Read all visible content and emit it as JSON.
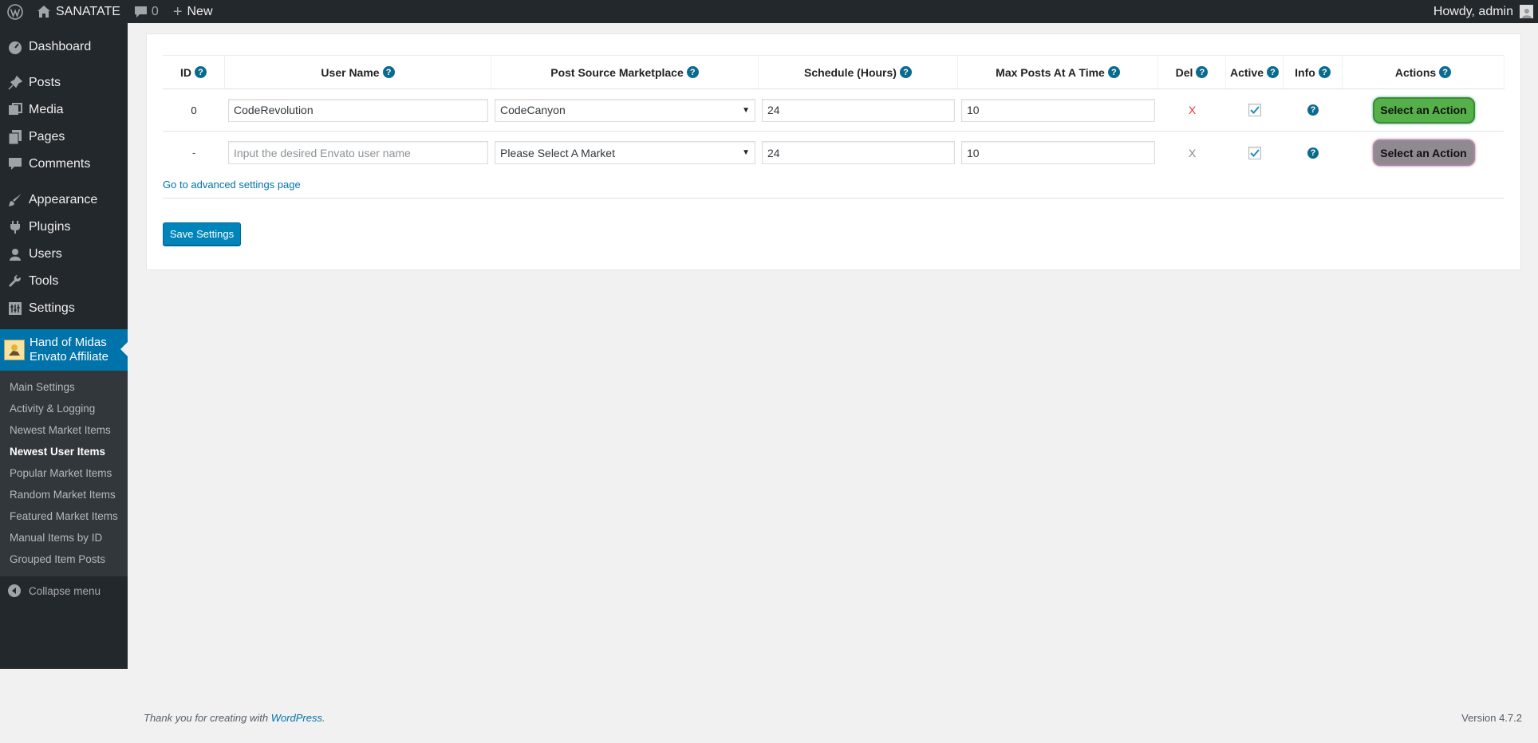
{
  "adminbar": {
    "site_name": "SANATATE",
    "comments_count": "0",
    "new_label": "New",
    "howdy": "Howdy, admin"
  },
  "sidebar": {
    "items": [
      {
        "label": "Dashboard",
        "icon": "dashboard-icon"
      },
      {
        "label": "Posts",
        "icon": "pin-icon"
      },
      {
        "label": "Media",
        "icon": "media-icon"
      },
      {
        "label": "Pages",
        "icon": "pages-icon"
      },
      {
        "label": "Comments",
        "icon": "comment-icon"
      },
      {
        "label": "Appearance",
        "icon": "brush-icon"
      },
      {
        "label": "Plugins",
        "icon": "plugin-icon"
      },
      {
        "label": "Users",
        "icon": "user-icon"
      },
      {
        "label": "Tools",
        "icon": "wrench-icon"
      },
      {
        "label": "Settings",
        "icon": "settings-icon"
      }
    ],
    "active_plugin_line1": "Hand of Midas",
    "active_plugin_line2": "Envato Affiliate",
    "submenu": [
      "Main Settings",
      "Activity & Logging",
      "Newest Market Items",
      "Newest User Items",
      "Popular Market Items",
      "Random Market Items",
      "Featured Market Items",
      "Manual Items by ID",
      "Grouped Item Posts"
    ],
    "current_submenu": "Newest User Items",
    "collapse_label": "Collapse menu"
  },
  "table": {
    "headers": {
      "id": "ID",
      "user": "User Name",
      "market": "Post Source Marketplace",
      "schedule": "Schedule (Hours)",
      "max": "Max Posts At A Time",
      "del": "Del",
      "active": "Active",
      "info": "Info",
      "actions": "Actions"
    },
    "rows": [
      {
        "id": "0",
        "user": "CodeRevolution",
        "market": "CodeCanyon",
        "schedule": "24",
        "max": "10",
        "del": "X",
        "active": true,
        "action": "Select an Action"
      },
      {
        "id": "-",
        "user_placeholder": "Input the desired Envato user name",
        "market": "Please Select A Market",
        "schedule": "24",
        "max": "10",
        "del": "X",
        "active": true,
        "action": "Select an Action"
      }
    ],
    "help_glyph": "?"
  },
  "advanced_link": "Go to advanced settings page",
  "save_label": "Save Settings",
  "footer": {
    "thanks_prefix": "Thank you for creating with ",
    "wp_link": "WordPress",
    "thanks_suffix": ".",
    "version": "Version 4.7.2"
  },
  "colors": {
    "sidebar_bg": "#23282d",
    "accent": "#0073aa",
    "action_green": "#56b04a",
    "action_grey": "#8e8a8f",
    "delete_red": "#e33333"
  }
}
